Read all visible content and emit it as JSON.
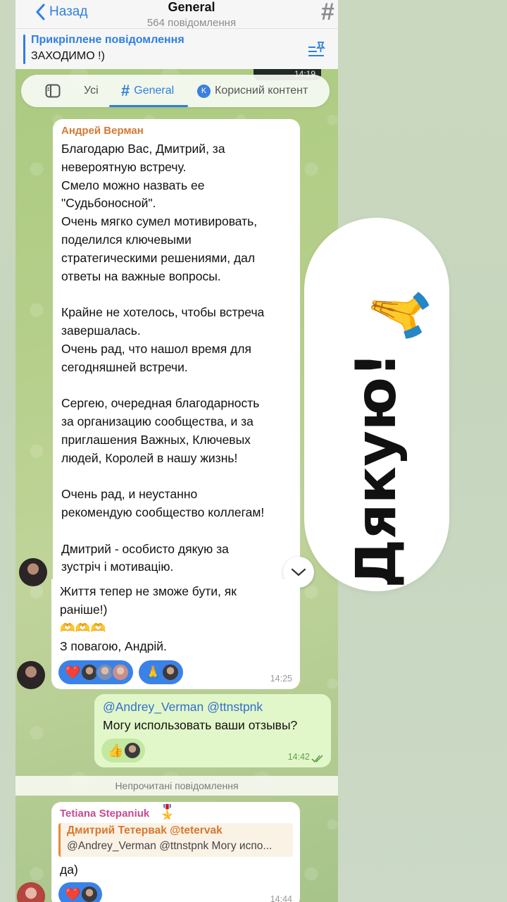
{
  "header": {
    "back_label": "Назад",
    "title": "General",
    "subtitle": "564 повідомлення",
    "hash_glyph": "#"
  },
  "pinned": {
    "label": "Прикріплене повідомлення",
    "text": "ЗАХОДИМО !)"
  },
  "top_snippet_time": "14:19",
  "tabs": {
    "all": "Усі",
    "general": "General",
    "general_hash": "#",
    "useful": "Корисний контент",
    "useful_badge": "K"
  },
  "messages": [
    {
      "sender": "Андрей Верман",
      "sender_color": "#d27a35",
      "text": "Благодарю Вас, Дмитрий, за\nневероятную встречу.\nСмело можно назвать ее\n\"Судьбоносной\".\nОчень мягко сумел мотивировать,\nподелился ключевыми\nстратегическими решениями, дал\nответы на важные вопросы.\n\nКрайне не хотелось, чтобы встреча\nзавершалась.\nОчень рад, что нашол время для\nсегодняшней встречи.\n\nСергею, очередная благодарность\nза организацию сообщества, и за\nприглашения Важных, Ключевых\nлюдей, Королей в нашу жизнь!\n\nОчень рад, и неустанно\nрекомендую сообщество коллегам!\n\nДмитрий - особисто дякую за\nзустріч і мотивацію."
    },
    {
      "text": "Життя тепер не зможе бути, як\nраніше!)\n🫶🫶🫶\nЗ повагою, Андрій.",
      "reactions": [
        "❤️",
        "🙏"
      ],
      "time": "14:25"
    },
    {
      "mentions": "@Andrey_Verman @ttnstpnk",
      "text": "Могу использовать ваши отзывы?",
      "reactions": [
        "👍"
      ],
      "time": "14:42",
      "outgoing": true
    },
    {
      "sender": "Tetiana Stepaniuk",
      "sender_emoji": "🎖️",
      "sender_color": "#c64c90",
      "reply_name": "Дмитрий Тетерваk @tetervak",
      "reply_text": "@Andrey_Verman @ttnstpnk Могу испо...",
      "text": "да)",
      "reactions": [
        "❤️"
      ],
      "time": "14:44"
    }
  ],
  "unread_label": "Непрочитані повідомлення",
  "sticker": {
    "text": "Дякую!",
    "emoji": "🙏"
  },
  "colors": {
    "accent": "#2f7fe0",
    "outgoing_bubble": "#e2f7c9",
    "reaction": "#3b82e8"
  }
}
